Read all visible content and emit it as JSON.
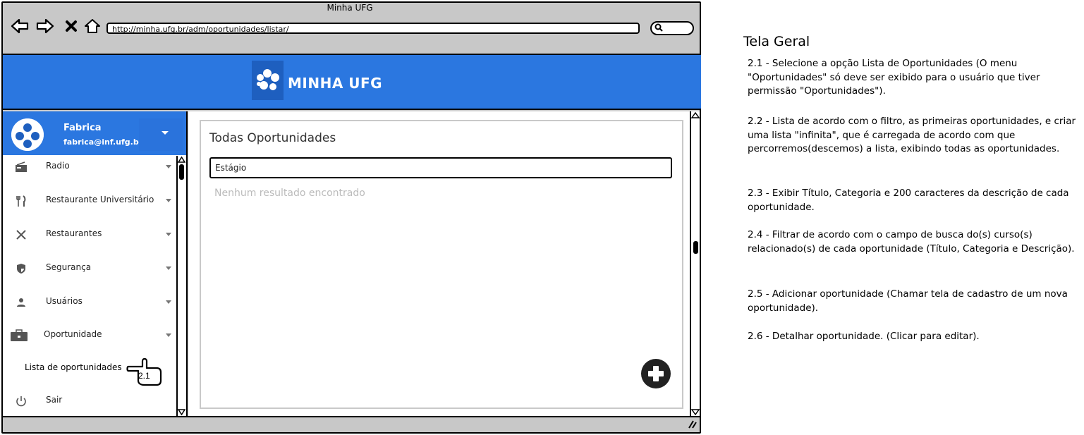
{
  "browser": {
    "title": "Minha UFG",
    "url": "http://minha.ufg.br/adm/oportunidades/listar/",
    "search_icon": "search-icon"
  },
  "app": {
    "brand": "MINHA UFG"
  },
  "user": {
    "name": "Fabrica",
    "email": "fabrica@inf.ufg.br"
  },
  "menu": [
    {
      "label": "Radio",
      "icon": "radio-icon"
    },
    {
      "label": "Restaurante Universitário",
      "icon": "cutlery-icon"
    },
    {
      "label": "Restaurantes",
      "icon": "utensils-cross-icon"
    },
    {
      "label": "Segurança",
      "icon": "shield-icon"
    },
    {
      "label": "Usuários",
      "icon": "user-icon"
    },
    {
      "label": "Oportunidade",
      "icon": "briefcase-icon"
    }
  ],
  "submenu": {
    "label": "Lista de oportunidades",
    "marker": "2.1"
  },
  "logout": {
    "label": "Sair",
    "icon": "power-icon"
  },
  "main": {
    "title": "Todas Oportunidades",
    "filter_value": "Estágio",
    "empty_message": "Nenhum resultado encontrado"
  },
  "notes": {
    "title": "Tela Geral",
    "items": [
      "2.1 - Selecione a opção Lista de Oportunidades (O menu \"Oportunidades\" só deve ser exibido para o usuário que tiver permissão \"Oportunidades\").",
      "2.2 - Lista de acordo com o filtro, as primeiras oportunidades, e criar uma lista \"infinita\", que é carregada de acordo com que percorremos(descemos) a lista, exibindo todas as oportunidades.",
      "2.3 - Exibir Título, Categoria e 200 caracteres da descrição de cada oportunidade.",
      "2.4 - Filtrar de acordo com o campo de busca do(s) curso(s) relacionado(s) de cada oportunidade (Título, Categoria e Descrição).",
      "2.5 - Adicionar oportunidade (Chamar tela de cadastro de um nova oportunidade).",
      "2.6 - Detalhar oportunidade. (Clicar para editar)."
    ]
  }
}
